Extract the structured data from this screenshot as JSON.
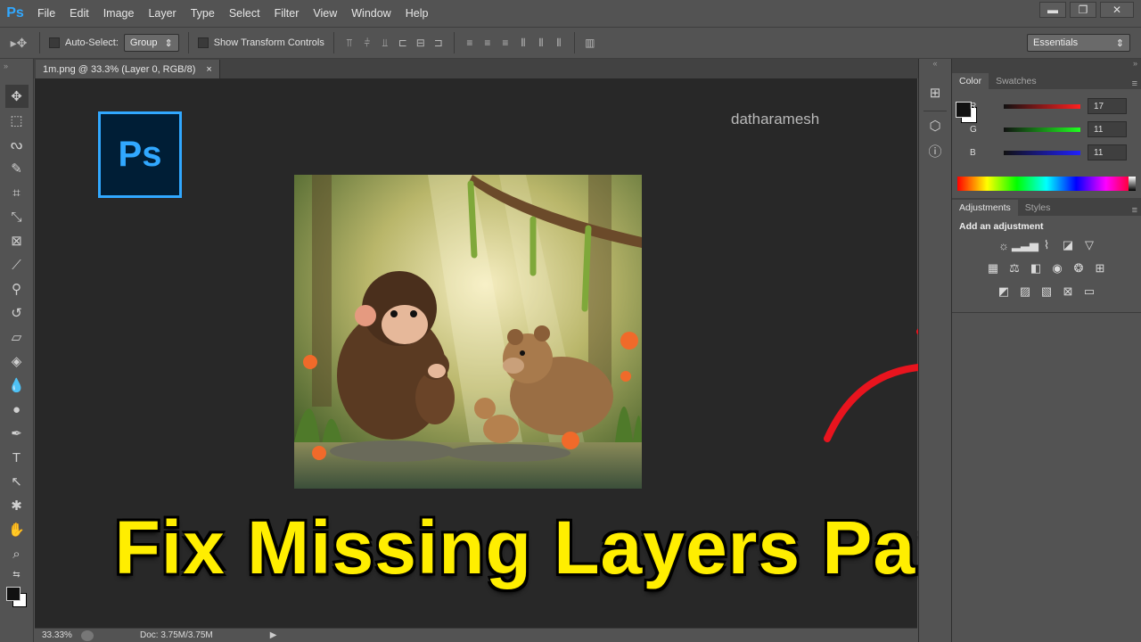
{
  "app": {
    "logo": "Ps",
    "accent_color": "#31a8ff"
  },
  "menu": [
    "File",
    "Edit",
    "Image",
    "Layer",
    "Type",
    "Select",
    "Filter",
    "View",
    "Window",
    "Help"
  ],
  "window_controls": {
    "minimize": "▬",
    "restore": "❐",
    "close": "✕"
  },
  "options_bar": {
    "auto_select_label": "Auto-Select:",
    "auto_select_value": "Group",
    "transform_label": "Show Transform Controls",
    "workspace": "Essentials"
  },
  "document": {
    "tab_label": "1m.png @ 33.3% (Layer 0, RGB/8)",
    "close": "×"
  },
  "canvas": {
    "logo_text": "Ps",
    "watermark": "datharamesh"
  },
  "color_panel": {
    "tabs": [
      "Color",
      "Swatches"
    ],
    "channels": [
      {
        "label": "R",
        "value": "17",
        "color": "#ff2020"
      },
      {
        "label": "G",
        "value": "11",
        "color": "#20ff20"
      },
      {
        "label": "B",
        "value": "11",
        "color": "#2020ff"
      }
    ]
  },
  "adjustments_panel": {
    "tabs": [
      "Adjustments",
      "Styles"
    ],
    "heading": "Add an adjustment",
    "icon_rows": [
      [
        "brightness-icon",
        "levels-icon",
        "curves-icon",
        "exposure-icon",
        "gradient-triangle-icon"
      ],
      [
        "vibrance-icon",
        "color-balance-icon",
        "black-white-icon",
        "photo-filter-icon",
        "channel-mixer-icon",
        "color-lookup-icon"
      ],
      [
        "invert-icon",
        "posterize-icon",
        "threshold-icon",
        "selective-color-icon",
        "gradient-map-icon"
      ]
    ]
  },
  "status_bar": {
    "zoom": "33.33%",
    "doc_size": "Doc: 3.75M/3.75M"
  },
  "overlay_title": {
    "text": "Fix Missing Layers Panel",
    "color": "#ffee00"
  },
  "arrow_color": "#e8141e"
}
